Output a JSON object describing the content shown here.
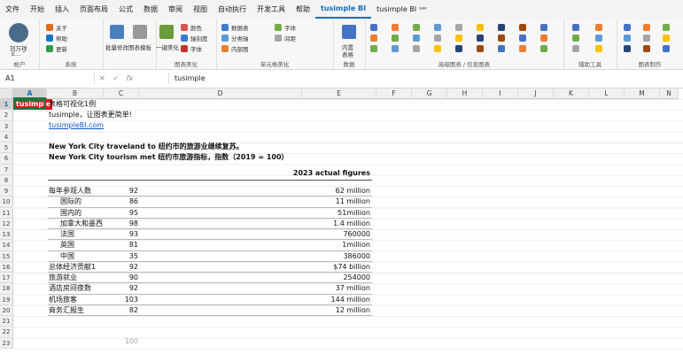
{
  "menu": [
    "文件",
    "开始",
    "插入",
    "页面布局",
    "公式",
    "数据",
    "审阅",
    "视图",
    "自动执行",
    "开发工具",
    "帮助",
    "tusimple BI",
    "tusimple BI ˢᵃᵛ"
  ],
  "menu_active": 11,
  "ribbon": {
    "user": {
      "name": "刘万祥",
      "sub": "E... ˅",
      "group": "帐户"
    },
    "system": {
      "items": [
        "关于",
        "帮助",
        "更新"
      ],
      "group": "系统"
    },
    "misc": {
      "items": [
        "批量修改",
        "图表模板",
        "一键美化"
      ]
    },
    "chart_tools": {
      "items": [
        "颜色",
        "轴刻度",
        "字体"
      ],
      "group": "图表美化"
    },
    "cell_beautify": {
      "items": [
        "数据表",
        "分类轴",
        "内部图",
        "字体",
        "间距"
      ],
      "group": "单元格美化"
    },
    "layout": {
      "items": [
        "内置",
        "表格"
      ],
      "group": "数据"
    },
    "advanced": {
      "group": "高级图表 / 信息图表"
    },
    "auxiliary": {
      "group": "辅助工具"
    },
    "chart_make": {
      "group": "图表制作"
    }
  },
  "formula": {
    "name_box": "A1",
    "fx": "fx",
    "content": "tusimple"
  },
  "columns": [
    "A",
    "B",
    "C",
    "D",
    "E",
    "F",
    "G",
    "H",
    "I",
    "J",
    "K",
    "L",
    "M",
    "N"
  ],
  "rows": [
    "1",
    "2",
    "3",
    "4",
    "5",
    "6",
    "7",
    "8",
    "9",
    "10",
    "11",
    "12",
    "13",
    "14",
    "15",
    "16",
    "17",
    "18",
    "19",
    "20",
    "21",
    "22",
    "23"
  ],
  "sheet": {
    "a1": "tusimple",
    "title": "表格可视化1例",
    "subtitle": "tusimple，让图表更简单!",
    "link": "tusimpleBI.com",
    "heading1": "New York City traveland to 纽约市的旅游业继续复苏。",
    "heading2": "New York City tourism met 纽约市旅游指标，指数（2019 = 100）",
    "col_header": "2023 actual figures",
    "rows": [
      {
        "label": "每年参观人数",
        "indent": false,
        "index": "92",
        "actual": "62 million"
      },
      {
        "label": "国际的",
        "indent": true,
        "index": "86",
        "actual": "11 million"
      },
      {
        "label": "国内的",
        "indent": true,
        "index": "95",
        "actual": "51million"
      },
      {
        "label": "加拿大和墨西",
        "indent": true,
        "index": "98",
        "actual": "1.4 million"
      },
      {
        "label": "法国",
        "indent": true,
        "index": "93",
        "actual": "760000"
      },
      {
        "label": "英国",
        "indent": true,
        "index": "81",
        "actual": "1million"
      },
      {
        "label": "中国",
        "indent": true,
        "index": "35",
        "actual": "386000"
      },
      {
        "label": "总体经济贡献1",
        "indent": false,
        "index": "92",
        "actual": "$74 billion"
      },
      {
        "label": "旅游就业",
        "indent": false,
        "index": "90",
        "actual": "254000"
      },
      {
        "label": "酒店房间夜数",
        "indent": false,
        "index": "92",
        "actual": "37 million"
      },
      {
        "label": "机场旅客",
        "indent": false,
        "index": "103",
        "actual": "144 million"
      },
      {
        "label": "商务汇报生",
        "indent": false,
        "index": "82",
        "actual": "12 million"
      }
    ],
    "c22": "100"
  },
  "colors": {
    "accent": "#217346",
    "tag": "#e0161c",
    "link": "#1155cc"
  }
}
